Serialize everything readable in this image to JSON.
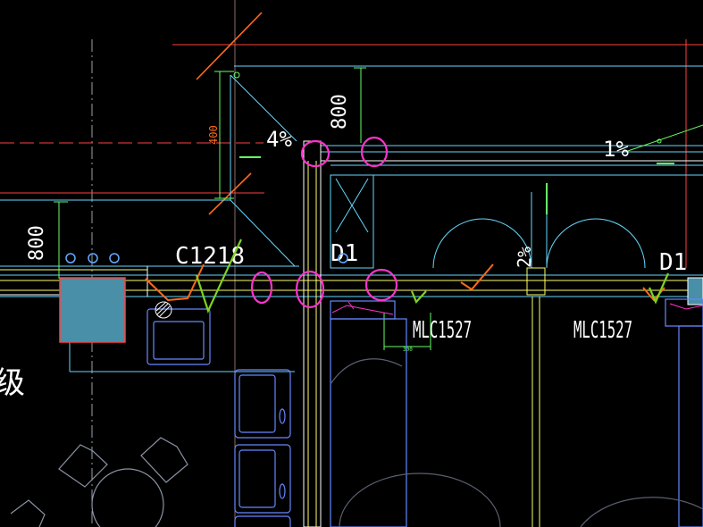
{
  "drawing": {
    "labels": {
      "c1218": "C1218",
      "d1_left": "D1",
      "d1_right": "D1",
      "mlc_left": "MLC1527",
      "mlc_right": "MLC1527",
      "dim_800_top": "800",
      "dim_800_left": "800",
      "dim_400": "400",
      "slope_4": "4%",
      "slope_1": "1%",
      "slope_2": "2%",
      "dim_small": "300",
      "glyph_left": "级"
    },
    "colors": {
      "background": "#000000",
      "wall": "#ffffff",
      "wall_accent": "#ffff66",
      "dimension": "#66ff66",
      "cyan_lines": "#66d9ff",
      "red_lines": "#ff4040",
      "orange_marks": "#ff6a1a",
      "magenta_marks": "#ff33cc",
      "green_checks": "#7ed321",
      "fixture_blue": "#6688ff",
      "fill_block": "#4a8fa8"
    }
  }
}
